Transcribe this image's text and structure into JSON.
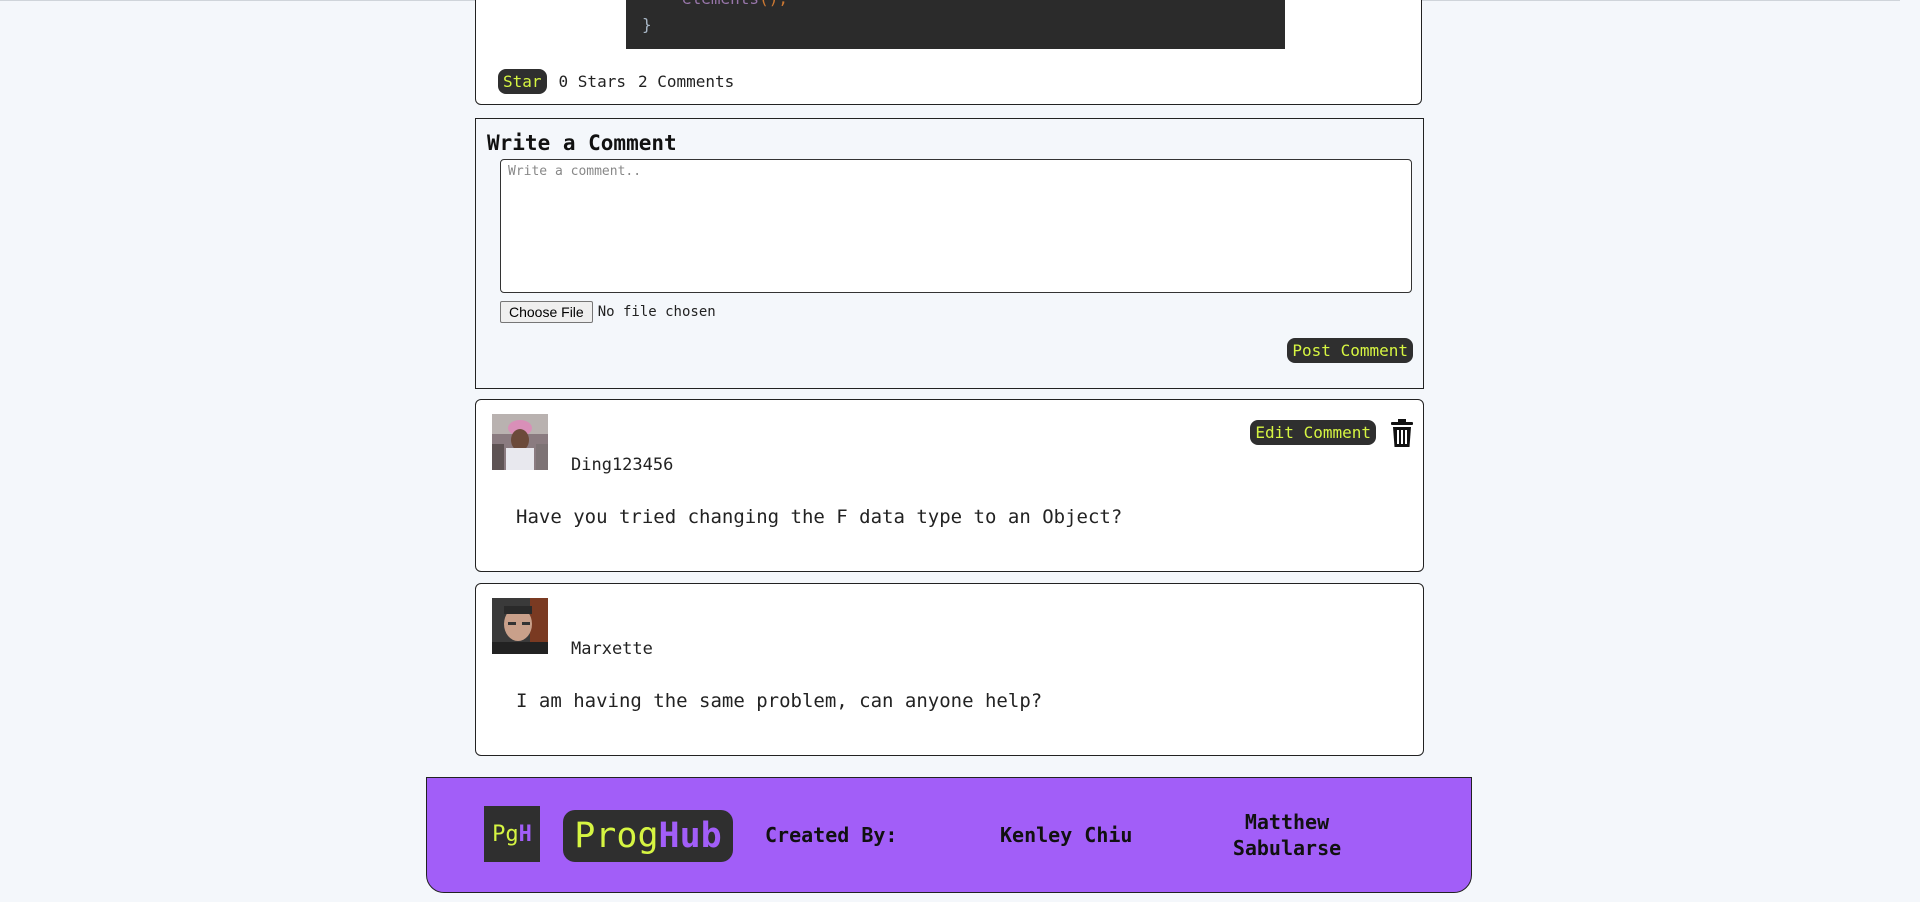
{
  "post": {
    "code_line1": "elements",
    "code_line1_punct": "();",
    "code_line2": "}",
    "star_label": "Star",
    "stars_count": "0 Stars",
    "comments_count": "2 Comments"
  },
  "write_comment": {
    "title": "Write a Comment",
    "placeholder": "Write a comment..",
    "choose_file_label": "Choose File",
    "file_status": "No file chosen",
    "post_label": "Post Comment"
  },
  "comments": [
    {
      "username": "Ding123456",
      "text": "Have you tried changing the F data type to an Object?",
      "edit_label": "Edit Comment"
    },
    {
      "username": "Marxette",
      "text": "I am having the same problem, can anyone help?"
    }
  ],
  "footer": {
    "logo_small_pg": "Pg",
    "logo_small_h": "H",
    "logo_big_prog": "Prog",
    "logo_big_hub": "Hub",
    "created_by": "Created By:",
    "creator1": "Kenley Chiu",
    "creator2": "Matthew Sabularse"
  },
  "colors": {
    "accent_yellow": "#d6f542",
    "accent_purple": "#a25ef8",
    "dark_button": "#2f2f2f"
  }
}
